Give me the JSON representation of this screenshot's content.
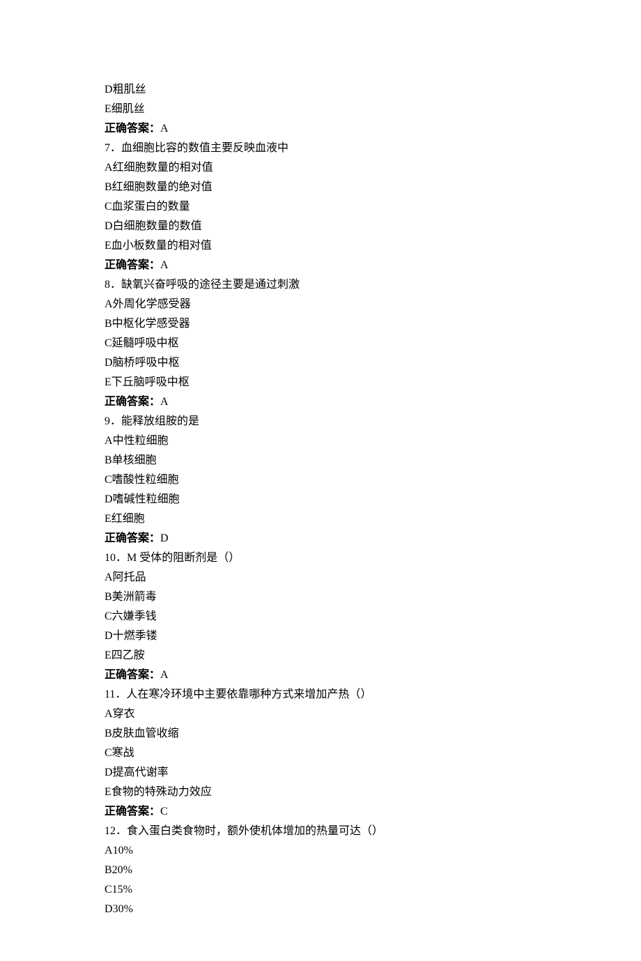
{
  "questions": [
    {
      "options": [
        {
          "label": "D",
          "text": "粗肌丝"
        },
        {
          "label": "E",
          "text": "细肌丝"
        }
      ],
      "answer_label": "正确答案：",
      "answer_value": "A"
    },
    {
      "number": "7",
      "sep": "．",
      "stem": "血细胞比容的数值主要反映血液中",
      "options": [
        {
          "label": "A",
          "text": "红细胞数量的相对值"
        },
        {
          "label": "B",
          "text": "红细胞数量的绝对值"
        },
        {
          "label": "C",
          "text": "血浆蛋白的数量"
        },
        {
          "label": "D",
          "text": "白细胞数量的数值"
        },
        {
          "label": "E",
          "text": "血小板数量的相对值"
        }
      ],
      "answer_label": "正确答案：",
      "answer_value": "A"
    },
    {
      "number": "8",
      "sep": "．",
      "stem": "缺氧兴奋呼吸的途径主要是通过刺激",
      "options": [
        {
          "label": "A",
          "text": "外周化学感受器"
        },
        {
          "label": "B",
          "text": "中枢化学感受器"
        },
        {
          "label": "C",
          "text": "延髓呼吸中枢"
        },
        {
          "label": "D",
          "text": "脑桥呼吸中枢"
        },
        {
          "label": "E",
          "text": "下丘脑呼吸中枢"
        }
      ],
      "answer_label": "正确答案：",
      "answer_value": "A"
    },
    {
      "number": "9",
      "sep": "．",
      "stem": "能释放组胺的是",
      "options": [
        {
          "label": "A",
          "text": "中性粒细胞"
        },
        {
          "label": "B",
          "text": "单核细胞"
        },
        {
          "label": "C",
          "text": "嗜酸性粒细胞"
        },
        {
          "label": "D",
          "text": "嗜碱性粒细胞"
        },
        {
          "label": "E",
          "text": "红细胞"
        }
      ],
      "answer_label": "正确答案：",
      "answer_value": "D"
    },
    {
      "number": "10",
      "sep": "．",
      "stem": "M 受体的阻断剂是（）",
      "options": [
        {
          "label": "A",
          "text": "阿托品"
        },
        {
          "label": "B",
          "text": "美洲箭毒"
        },
        {
          "label": "C",
          "text": "六嫌季钱"
        },
        {
          "label": "D",
          "text": "十燃季镂"
        },
        {
          "label": "E",
          "text": "四乙胺"
        }
      ],
      "answer_label": "正确答案：",
      "answer_value": "A"
    },
    {
      "number": "11",
      "sep": "．",
      "stem": "人在寒冷环境中主要依靠哪种方式来增加产热（）",
      "options": [
        {
          "label": "A",
          "text": "穿衣"
        },
        {
          "label": "B",
          "text": "皮肤血管收缩"
        },
        {
          "label": "C",
          "text": "寒战"
        },
        {
          "label": "D",
          "text": "提高代谢率"
        },
        {
          "label": "E",
          "text": "食物的特殊动力效应"
        }
      ],
      "answer_label": "正确答案：",
      "answer_value": "C"
    },
    {
      "number": "12",
      "sep": "．",
      "stem": "食入蛋白类食物时，额外使机体增加的热量可达（）",
      "options": [
        {
          "label": "A",
          "text": "10%"
        },
        {
          "label": "B",
          "text": "20%"
        },
        {
          "label": "C",
          "text": "15%"
        },
        {
          "label": "D",
          "text": "30%"
        }
      ]
    }
  ]
}
